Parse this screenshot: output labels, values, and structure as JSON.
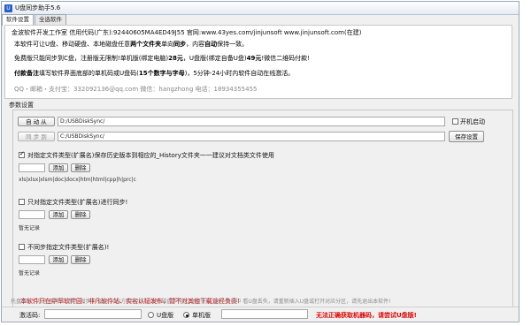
{
  "window": {
    "title": "U盘同步助手5.6",
    "icon": "usb-app-icon"
  },
  "tabs": [
    "软件设置",
    "全选软件"
  ],
  "info": {
    "line1": "金波软件开发工作室  信用代码(广东):92440605MA4ED49J55  官网:www.43yes.com/jinjunsoft  www.jinjunsoft.com(在建)",
    "line2_prefix": "本软件可让U盘、移动硬盘、本地磁盘任意",
    "line2_bold1": "两个文件夹",
    "line2_mid": "单向",
    "line2_bold2": "同步",
    "line2_mid2": "，内容",
    "line2_bold3": "自动",
    "line2_suffix": "保持一致。",
    "line3_prefix": "免费版只能同步到C盘，注册版无限制!单机版(绑定电脑)",
    "line3_bold1": "28元",
    "line3_mid": "，U盘版(绑定自备U盘)",
    "line3_bold2": "49元",
    "line3_suffix": "!微信二维码付款!",
    "line4_bold1": "付款备注",
    "line4_prefix": "填写软件界面底部的单机码或U盘码(",
    "line4_bold2": "15个数字与字母",
    "line4_suffix": ")，5分钟-24小时内软件自动在线激活。",
    "line5": "QQ・邮箱・支付宝：332092136@qq.com          微信：hangzhong      电话：18934355455"
  },
  "params": {
    "section_label": "参数设置",
    "sync_from_label": "自 动 从",
    "sync_from_path": "D:/USBDiskSync/",
    "sync_to_label": "同 步 到",
    "sync_to_path": "C:/USBDiskSync/",
    "autostart_label": "开机启动",
    "autostart_checked": false,
    "save_label": "保存设置",
    "history": {
      "checked": true,
      "label": "对指定文件类型(扩展名)保存历史版本到相应的_History文件夹一一建议对文档类文件使用",
      "add": "添加",
      "delete": "删除",
      "extensions": "xls|xlsx|xlsm|doc|docx|htm|html|cpp|h|prc|c"
    },
    "only": {
      "checked": false,
      "label": "只对指定文件类型(扩展名)进行同步!",
      "add": "添加",
      "delete": "删除",
      "none": "暂无记录"
    },
    "exclude": {
      "checked": false,
      "label": "不同步指定文件类型(扩展名)!",
      "add": "添加",
      "delete": "删除",
      "none": "暂无记录"
    },
    "warning": "本软件只在华军软件园、非凡软件站、实名认证发布，暂不对其他下载途径负责!"
  },
  "status": {
    "hint": "托盘图标：灰色-暂停中 绿色-同步中 蓝色-对应方向同步中 红色-磁盘不存在/连接失败 黄色-等待中  看U盘丢失，请重新插入U盘或打开对应分区，请先退出本软件!",
    "reg_label": "激活码:",
    "radio_u": "U盘版",
    "radio_pc": "单机版",
    "mode_selected": "单机版",
    "error": "无法正确获取机器码，请尝试U盘版!",
    "colors": {
      "error": "#e00000",
      "warning": "#d40000"
    }
  }
}
